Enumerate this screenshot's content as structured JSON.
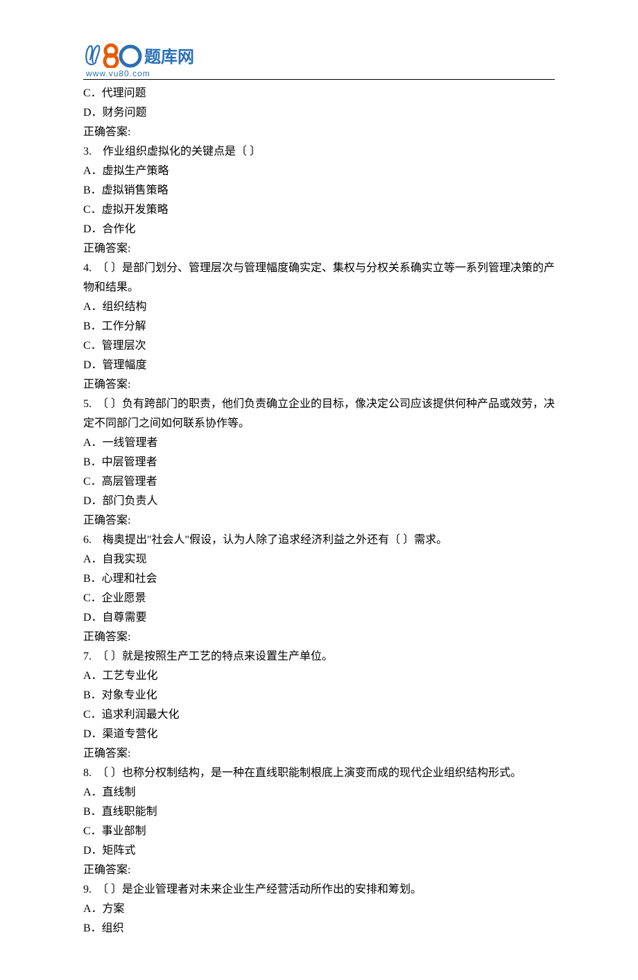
{
  "logo": {
    "url_parts": [
      "www",
      ".",
      "vu80",
      ".",
      "com"
    ],
    "alt": "U80题库网"
  },
  "prev_options": [
    {
      "label": "C．代理问题"
    },
    {
      "label": "D．财务问题"
    }
  ],
  "answer_label": "正确答案:",
  "questions": [
    {
      "num": "3.",
      "stem": "　作业组织虚拟化的关键点是〔  〕",
      "options": [
        "A．虚拟生产策略",
        "B．虚拟销售策略",
        "C．虚拟开发策略",
        "D．合作化"
      ]
    },
    {
      "num": "4.",
      "stem": "　〔  〕是部门划分、管理层次与管理幅度确实定、集权与分权关系确实立等一系列管理决策的产物和结果。",
      "options": [
        "A．组织结构",
        "B．工作分解",
        "C．管理层次",
        "D．管理幅度"
      ]
    },
    {
      "num": "5.",
      "stem": "　〔  〕负有跨部门的职责，他们负责确立企业的目标，像决定公司应该提供何种产品或效劳，决定不同部门之间如何联系协作等。",
      "options": [
        "A．一线管理者",
        "B．中层管理者",
        "C．高层管理者",
        "D．部门负责人"
      ]
    },
    {
      "num": "6.",
      "stem": "　梅奥提出\"社会人\"假设，认为人除了追求经济利益之外还有〔  〕需求。",
      "options": [
        "A．自我实现",
        "B．心理和社会",
        "C．企业愿景",
        "D．自尊需要"
      ]
    },
    {
      "num": "7.",
      "stem": "　〔  〕就是按照生产工艺的特点来设置生产单位。",
      "options": [
        "A．工艺专业化",
        "B．对象专业化",
        "C．追求利润最大化",
        "D．渠道专营化"
      ]
    },
    {
      "num": "8.",
      "stem": "　〔  〕也称分权制结构，是一种在直线职能制根底上演变而成的现代企业组织结构形式。",
      "options": [
        "A．直线制",
        "B．直线职能制",
        "C．事业部制",
        "D．矩阵式"
      ]
    },
    {
      "num": "9.",
      "stem": "　〔  〕是企业管理者对未来企业生产经营活动所作出的安排和筹划。",
      "options": [
        "A．方案",
        "B．组织"
      ]
    }
  ]
}
